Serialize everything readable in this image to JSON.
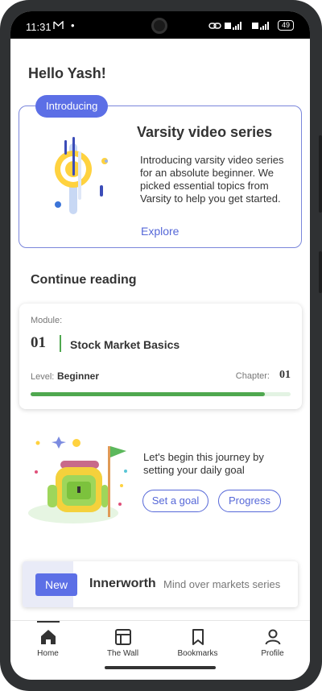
{
  "status_bar": {
    "time": "11:31",
    "mail_icon": "M",
    "dot": "•",
    "network": "LTE 5G+",
    "battery": "49"
  },
  "greeting": "Hello Yash!",
  "intro": {
    "badge": "Introducing",
    "title": "Varsity video series",
    "description": "Introducing varsity video series for an absolute beginner. We picked essential topics from Varsity to help you get started.",
    "link": "Explore"
  },
  "continue_reading": {
    "title": "Continue reading",
    "module_label": "Module:",
    "module_number": "01",
    "module_name": "Stock Market Basics",
    "level_label": "Level:",
    "level_value": "Beginner",
    "chapter_label": "Chapter:",
    "chapter_value": "01",
    "progress": 0.9
  },
  "goal": {
    "text": "Let's begin this journey by setting your daily goal",
    "set_goal_button": "Set a goal",
    "progress_button": "Progress"
  },
  "innerworth": {
    "badge": "New",
    "title": "Innerworth",
    "subtitle": "Mind over markets series"
  },
  "bottom_nav": [
    {
      "label": "Home",
      "icon": "home-icon",
      "active": true
    },
    {
      "label": "The Wall",
      "icon": "wall-icon",
      "active": false
    },
    {
      "label": "Bookmarks",
      "icon": "bookmark-icon",
      "active": false
    },
    {
      "label": "Profile",
      "icon": "profile-icon",
      "active": false
    }
  ],
  "colors": {
    "accent": "#5c6fe6",
    "progress": "#4fa84f",
    "text": "#333333"
  }
}
